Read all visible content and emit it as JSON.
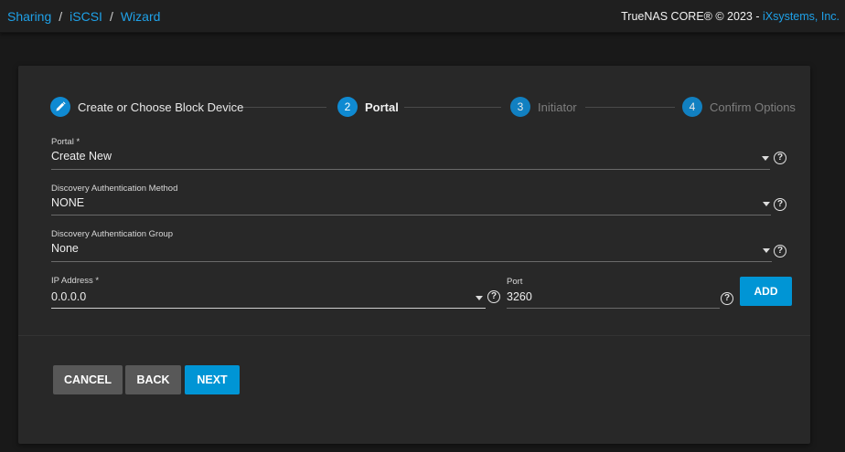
{
  "breadcrumb": {
    "items": [
      "Sharing",
      "iSCSI",
      "Wizard"
    ],
    "separator": "/"
  },
  "header": {
    "copyright_prefix": "TrueNAS CORE® © 2023 - ",
    "company": "iXsystems, Inc."
  },
  "stepper": {
    "steps": [
      {
        "number": "",
        "icon": "pencil-icon",
        "label": "Create or Choose Block Device",
        "state": "done"
      },
      {
        "number": "2",
        "label": "Portal",
        "state": "active"
      },
      {
        "number": "3",
        "label": "Initiator",
        "state": "pending"
      },
      {
        "number": "4",
        "label": "Confirm Options",
        "state": "pending"
      }
    ]
  },
  "form": {
    "portal": {
      "label": "Portal *",
      "value": "Create New"
    },
    "discovery_auth_method": {
      "label": "Discovery Authentication Method",
      "value": "NONE"
    },
    "discovery_auth_group": {
      "label": "Discovery Authentication Group",
      "value": "None"
    },
    "ip_address": {
      "label": "IP Address *",
      "value": "0.0.0.0"
    },
    "port": {
      "label": "Port",
      "value": "3260"
    },
    "help_glyph": "?",
    "add_label": "ADD"
  },
  "actions": {
    "cancel_label": "CANCEL",
    "back_label": "BACK",
    "next_label": "NEXT"
  },
  "colors": {
    "accent": "#0095d5",
    "link": "#1fa1e8",
    "background": "#191919",
    "card": "#282828"
  }
}
